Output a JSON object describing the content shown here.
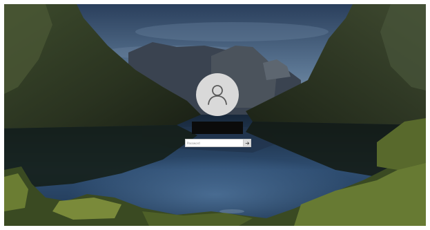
{
  "lock_screen": {
    "user_name": "",
    "password_placeholder": "Password"
  },
  "icons": {
    "avatar": "user-icon",
    "submit": "arrow-right-icon"
  },
  "colors": {
    "avatar_bg": "#d9d9d9",
    "username_bg": "#0b0b0b",
    "input_bg": "#ffffff"
  }
}
